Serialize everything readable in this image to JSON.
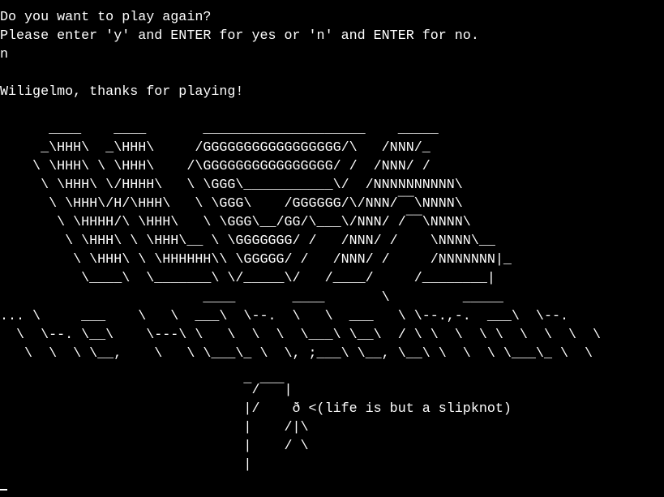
{
  "terminal": {
    "colors": {
      "background": "#000000",
      "foreground": "#ffffff"
    },
    "prompt": {
      "question": "Do you want to play again?",
      "instructions": "Please enter 'y' and ENTER for yes or 'n' and ENTER for no.",
      "user_input": "n"
    },
    "farewell": "Wiligelmo, thanks for playing!",
    "banner_art": [
      "      ____    ____       ____________________    _____",
      "     _\\HHH\\  _\\HHH\\     /GGGGGGGGGGGGGGGGG/\\   /NNN/_",
      "    \\ \\HHH\\ \\ \\HHH\\    /\\GGGGGGGGGGGGGGGG/ /  /NNN/ /",
      "     \\ \\HHH\\ \\/HHHH\\   \\ \\GGG\\___________\\/  /NNNNNNNNNN\\",
      "      \\ \\HHH\\/H/\\HHH\\   \\ \\GGG\\    /GGGGGG/\\/NNN/¯¯\\NNNN\\",
      "       \\ \\HHHH/\\ \\HHH\\   \\ \\GGG\\__/GG/\\___\\/NNN/ /¯¯\\NNNN\\",
      "        \\ \\HHH\\ \\ \\HHH\\__ \\ \\GGGGGGG/ /   /NNN/ /    \\NNNN\\__",
      "         \\ \\HHH\\ \\ \\HHHHHH\\\\ \\GGGGG/ /   /NNN/ /     /NNNNNNN|_",
      "          \\____\\  \\_______\\ \\/_____\\/   /____/     /________|"
    ],
    "wordmark_art": [
      "                         ____       ____       \\         _____",
      "... \\     ___    \\   \\  ___\\  \\--.  \\   \\  ___   \\ \\--.,-.  ___\\  \\--.",
      "  \\  \\--. \\__\\    \\---\\ \\   \\  \\  \\  \\___\\ \\__\\  / \\ \\  \\  \\ \\  \\  \\  \\  \\",
      "   \\  \\  \\ \\__,    \\   \\ \\___\\_ \\  \\, ;___\\ \\__, \\__\\ \\  \\  \\ \\___\\_ \\  \\"
    ],
    "gallows_art": [
      "                              ¯/¯¯¯|",
      "                              |/    ð <(life is but a slipknot)",
      "                              |    /|\\",
      "                              |    / \\",
      "                              |"
    ]
  }
}
